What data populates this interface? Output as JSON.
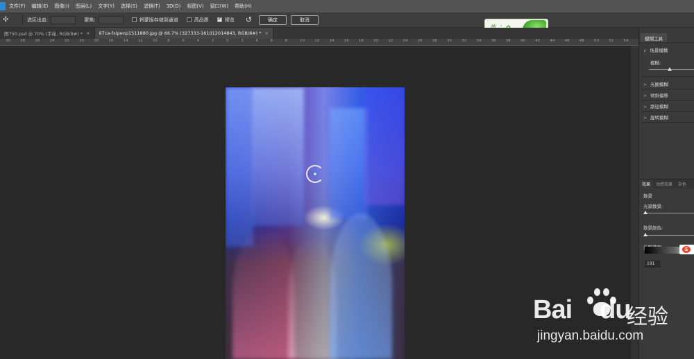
{
  "menubar": {
    "items": [
      "文件(F)",
      "编辑(E)",
      "图像(I)",
      "图层(L)",
      "文字(Y)",
      "选择(S)",
      "滤镜(T)",
      "3D(D)",
      "视图(V)",
      "窗口(W)",
      "帮助(H)"
    ]
  },
  "options": {
    "output_label": "选区出血:",
    "focus_label": "聚焦:",
    "save_mask_label": "将蒙版存储到通道",
    "high_quality_label": "高品质",
    "preview_label": "预览",
    "preview_checked": true,
    "ok_label": "确定",
    "cancel_label": "取消"
  },
  "ime": {
    "char": "英"
  },
  "tabs": [
    {
      "label": "图750.psd @ 70% (手绘, RGB/8#) *",
      "active": false
    },
    {
      "label": "87ca-fxipenp1511880.jpg @ 66.7% (327333-161012014843, RGB/8#) *",
      "active": true
    }
  ],
  "ruler": {
    "ticks": [
      "30",
      "28",
      "26",
      "24",
      "22",
      "20",
      "18",
      "16",
      "14",
      "12",
      "10",
      "8",
      "6",
      "4",
      "2",
      "0",
      "2",
      "4",
      "6",
      "8",
      "10",
      "12",
      "14",
      "16",
      "18",
      "20",
      "22",
      "24",
      "26",
      "28",
      "30",
      "32",
      "34",
      "36",
      "38",
      "40",
      "42",
      "44",
      "46",
      "48",
      "50",
      "52",
      "54"
    ]
  },
  "panel": {
    "tab_label": "模糊工具",
    "field_blur": {
      "title": "场景模糊",
      "blur_label": "模糊:"
    },
    "collapsed_sections": [
      "光圈模糊",
      "倾斜偏移",
      "路径模糊",
      "旋转模糊"
    ],
    "lower_tabs": [
      "效果",
      "动感效果",
      "杂色"
    ],
    "effects": {
      "section_title": "散景",
      "light_bokeh_label": "光源散景:",
      "bokeh_color_label": "散景颜色:",
      "light_range_label": "光照范围:",
      "light_range_value": "191"
    }
  },
  "watermark": {
    "brand": "Bai",
    "brand_tail": "du",
    "cn": "经验",
    "url": "jingyan.baidu.com"
  },
  "colors": {
    "accent": "#2a8bd8",
    "menubar_bg": "#535353",
    "canvas_bg": "#282828"
  }
}
